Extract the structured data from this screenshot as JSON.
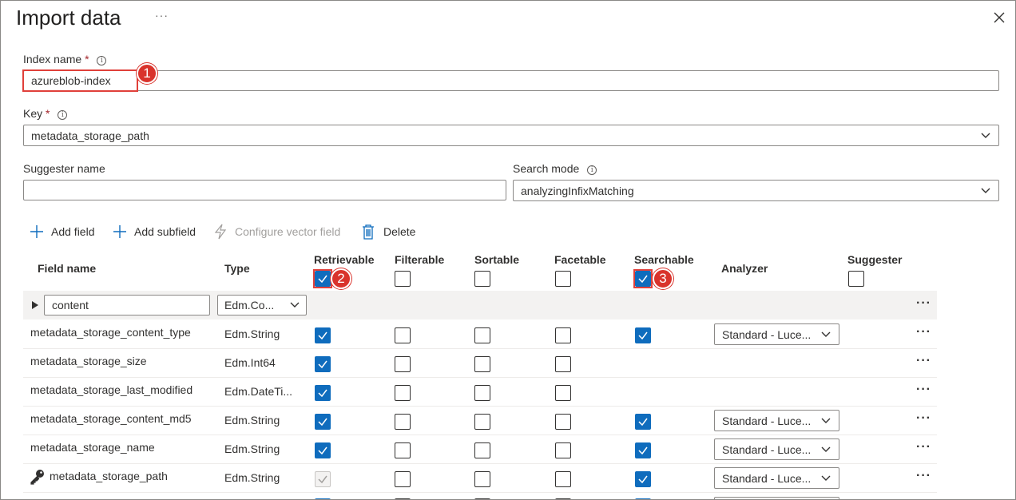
{
  "panel": {
    "title": "Import data",
    "more": "···"
  },
  "index_name": {
    "label": "Index name",
    "required": "*",
    "value": "azureblob-index",
    "badge": "1"
  },
  "key": {
    "label": "Key",
    "required": "*",
    "value": "metadata_storage_path"
  },
  "suggester_name": {
    "label": "Suggester name",
    "value": ""
  },
  "search_mode": {
    "label": "Search mode",
    "value": "analyzingInfixMatching"
  },
  "toolbar": {
    "add_field": "Add field",
    "add_subfield": "Add subfield",
    "configure_vector": "Configure vector field",
    "delete": "Delete"
  },
  "columns": {
    "field_name": "Field name",
    "type": "Type",
    "retrievable": "Retrievable",
    "filterable": "Filterable",
    "sortable": "Sortable",
    "facetable": "Facetable",
    "searchable": "Searchable",
    "analyzer": "Analyzer",
    "suggester": "Suggester"
  },
  "header_checks": {
    "retrievable": true,
    "filterable": false,
    "sortable": false,
    "facetable": false,
    "searchable": true,
    "suggester": false,
    "badge_retrievable": "2",
    "badge_searchable": "3"
  },
  "content_row": {
    "name": "content",
    "type": "Edm.Co...",
    "more": "···"
  },
  "rows": [
    {
      "name": "metadata_storage_content_type",
      "type": "Edm.String",
      "retrievable": true,
      "filterable": false,
      "sortable": false,
      "facetable": false,
      "searchable": true,
      "analyzer": "Standard - Luce...",
      "more": "···"
    },
    {
      "name": "metadata_storage_size",
      "type": "Edm.Int64",
      "retrievable": true,
      "filterable": false,
      "sortable": false,
      "facetable": false,
      "searchable": null,
      "analyzer": "",
      "more": "···"
    },
    {
      "name": "metadata_storage_last_modified",
      "type": "Edm.DateTi...",
      "retrievable": true,
      "filterable": false,
      "sortable": false,
      "facetable": false,
      "searchable": null,
      "analyzer": "",
      "more": "···"
    },
    {
      "name": "metadata_storage_content_md5",
      "type": "Edm.String",
      "retrievable": true,
      "filterable": false,
      "sortable": false,
      "facetable": false,
      "searchable": true,
      "analyzer": "Standard - Luce...",
      "more": "···"
    },
    {
      "name": "metadata_storage_name",
      "type": "Edm.String",
      "retrievable": true,
      "filterable": false,
      "sortable": false,
      "facetable": false,
      "searchable": true,
      "analyzer": "Standard - Luce...",
      "more": "···"
    },
    {
      "name": "metadata_storage_path",
      "type": "Edm.String",
      "retrievable": "disabled",
      "filterable": false,
      "sortable": false,
      "facetable": false,
      "searchable": true,
      "analyzer": "Standard - Luce...",
      "more": "···",
      "key_icon": true
    }
  ],
  "colors": {
    "accent": "#0f6cbd",
    "annotation": "#d9332c"
  }
}
